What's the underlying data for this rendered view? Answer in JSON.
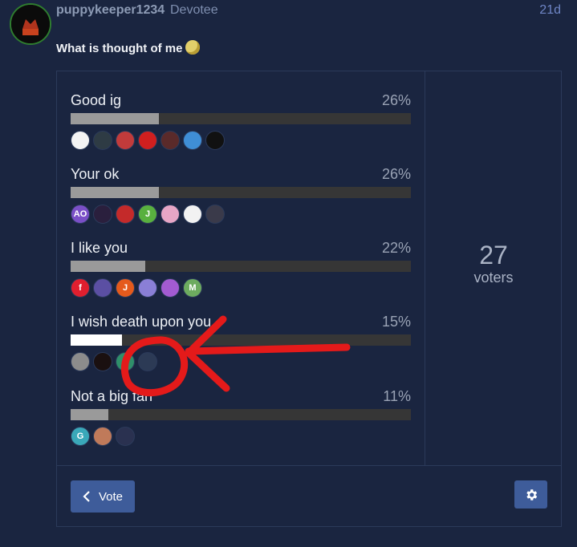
{
  "post": {
    "username": "puppykeeper1234",
    "user_title": "Devotee",
    "date": "21d",
    "text": "What is thought of me",
    "emoji_icon": "thinking-face-emoji"
  },
  "poll": {
    "options": [
      {
        "label": "Good ig",
        "percent": "26%",
        "fill": 26,
        "voters": [
          {
            "color": "#f4f4f4",
            "text": ""
          },
          {
            "color": "#2e3b44",
            "text": ""
          },
          {
            "color": "#c23b3b",
            "text": ""
          },
          {
            "color": "#d11f1f",
            "text": ""
          },
          {
            "color": "#5a2a2a",
            "text": ""
          },
          {
            "color": "#3f8ed6",
            "text": ""
          },
          {
            "color": "#111111",
            "text": ""
          }
        ]
      },
      {
        "label": "Your ok",
        "percent": "26%",
        "fill": 26,
        "voters": [
          {
            "color": "#7a4fc7",
            "text": "AO"
          },
          {
            "color": "#2a1f3d",
            "text": ""
          },
          {
            "color": "#c42a2a",
            "text": ""
          },
          {
            "color": "#59b03f",
            "text": "J"
          },
          {
            "color": "#e7a6c6",
            "text": ""
          },
          {
            "color": "#f2f2f2",
            "text": ""
          },
          {
            "color": "#3a3a4a",
            "text": ""
          }
        ]
      },
      {
        "label": "I like you",
        "percent": "22%",
        "fill": 22,
        "voters": [
          {
            "color": "#e01f2f",
            "text": "f"
          },
          {
            "color": "#5b4fa3",
            "text": ""
          },
          {
            "color": "#e55a1c",
            "text": "J"
          },
          {
            "color": "#8a7fd6",
            "text": ""
          },
          {
            "color": "#a35bd1",
            "text": ""
          },
          {
            "color": "#6dab5f",
            "text": "M"
          }
        ]
      },
      {
        "label": "I wish death upon you",
        "percent": "15%",
        "fill": 15,
        "highlight": true,
        "voters": [
          {
            "color": "#8c8c8c",
            "text": ""
          },
          {
            "color": "#1a1010",
            "text": ""
          },
          {
            "color": "#2f8f6a",
            "text": ""
          },
          {
            "color": "#2c3a55",
            "text": ""
          }
        ]
      },
      {
        "label": "Not a big fan",
        "percent": "11%",
        "fill": 11,
        "voters": [
          {
            "color": "#3aa8b9",
            "text": "G"
          },
          {
            "color": "#c07a5a",
            "text": ""
          },
          {
            "color": "#2a3150",
            "text": ""
          }
        ]
      }
    ],
    "voter_count": "27",
    "voter_label": "voters",
    "vote_button_label": "Vote",
    "settings_icon": "gear-icon"
  },
  "annotation_color": "#e41a1a"
}
